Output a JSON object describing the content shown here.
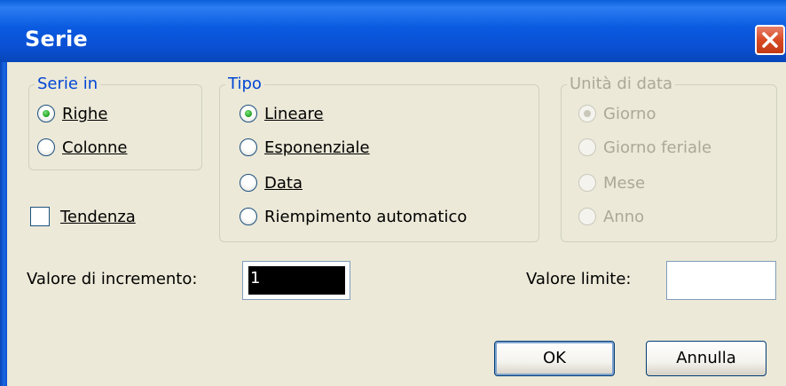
{
  "window": {
    "title": "Serie"
  },
  "serie_in": {
    "legend": "Serie in",
    "options": [
      {
        "label": "Righe",
        "checked": true,
        "enabled": true
      },
      {
        "label": "Colonne",
        "checked": false,
        "enabled": true
      }
    ]
  },
  "tipo": {
    "legend": "Tipo",
    "options": [
      {
        "label": "Lineare",
        "checked": true,
        "enabled": true
      },
      {
        "label": "Esponenziale",
        "checked": false,
        "enabled": true
      },
      {
        "label": "Data",
        "checked": false,
        "enabled": true
      },
      {
        "label": "Riempimento automatico",
        "checked": false,
        "enabled": true
      }
    ]
  },
  "unita_di_data": {
    "legend": "Unità di data",
    "options": [
      {
        "label": "Giorno",
        "checked": true,
        "enabled": false
      },
      {
        "label": "Giorno feriale",
        "checked": false,
        "enabled": false
      },
      {
        "label": "Mese",
        "checked": false,
        "enabled": false
      },
      {
        "label": "Anno",
        "checked": false,
        "enabled": false
      }
    ]
  },
  "tendenza": {
    "label": "Tendenza",
    "checked": false
  },
  "valore_incremento": {
    "label": "Valore di incremento:",
    "value": "1"
  },
  "valore_limite": {
    "label": "Valore limite:",
    "value": ""
  },
  "buttons": {
    "ok": "OK",
    "cancel": "Annulla"
  },
  "colors": {
    "titlebar": "#0a5ae0",
    "legend_text": "#0046d5",
    "disabled_text": "#aca899",
    "dialog_bg": "#ece9d8"
  },
  "icons": {
    "close": "close-icon"
  }
}
